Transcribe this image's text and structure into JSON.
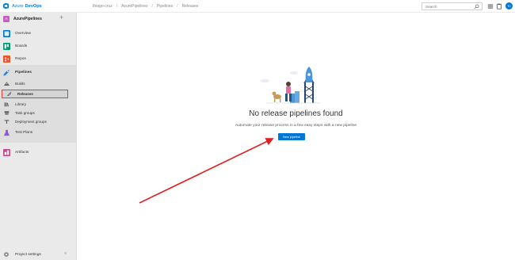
{
  "brand": {
    "azure": "Azure",
    "devops": "DevOps"
  },
  "breadcrumb": [
    "thiago-cruz",
    "AzurePipelines",
    "Pipelines",
    "Releases"
  ],
  "search": {
    "placeholder": "Search"
  },
  "user": {
    "initials": "TC"
  },
  "project": {
    "badge": "A",
    "name": "AzurePipelines"
  },
  "nav": {
    "overview": "Overview",
    "boards": "Boards",
    "repos": "Repos",
    "pipelines": "Pipelines",
    "builds": "Builds",
    "releases": "Releases",
    "library": "Library",
    "task_groups": "Task groups",
    "deployment_groups": "Deployment groups",
    "test_plans": "Test Plans",
    "artifacts": "Artifacts"
  },
  "settings": {
    "label": "Project settings"
  },
  "empty_state": {
    "title": "No release pipelines found",
    "description": "Automate your release process in a few easy steps with a new pipeline",
    "button": "New pipeline"
  },
  "colors": {
    "accent": "#0078d4",
    "highlight_box": "#e23c3c",
    "annotation_arrow": "#e01e1e"
  }
}
